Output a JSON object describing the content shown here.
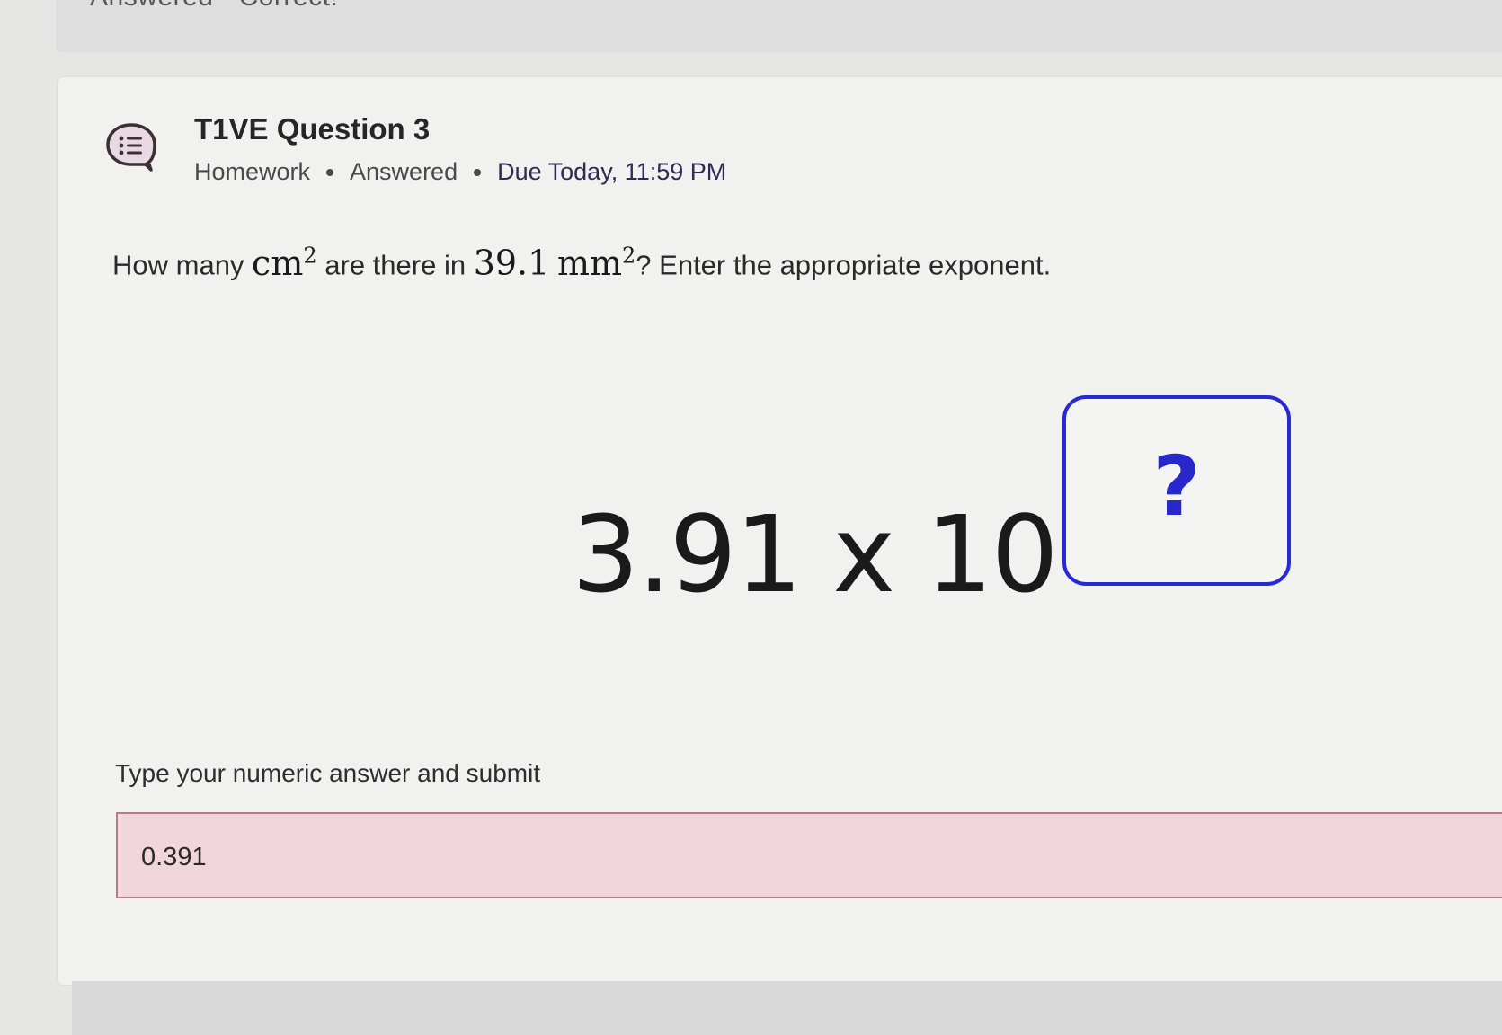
{
  "previous": {
    "status_text": "Answered - Correct!"
  },
  "question": {
    "icon": "question-list-icon",
    "title": "T1VE Question 3",
    "meta": {
      "type": "Homework",
      "status": "Answered",
      "due": "Due Today, 11:59 PM"
    },
    "prompt_parts": {
      "p1": "How many ",
      "unit1": "cm",
      "exp1": "2",
      "p2": " are there in ",
      "value": "39.1",
      "unit2": "mm",
      "exp2": "2",
      "p3": "? Enter the appropriate exponent."
    },
    "display": {
      "mantissa": "3.91",
      "times": "x",
      "base": "10",
      "exponent_placeholder": "?"
    },
    "answer_prompt": "Type your numeric answer and submit",
    "answer_value": "0.391"
  },
  "colors": {
    "accent_blue": "#2828d8",
    "wrong_fill": "#f0d6da",
    "wrong_border": "#b87a86"
  }
}
